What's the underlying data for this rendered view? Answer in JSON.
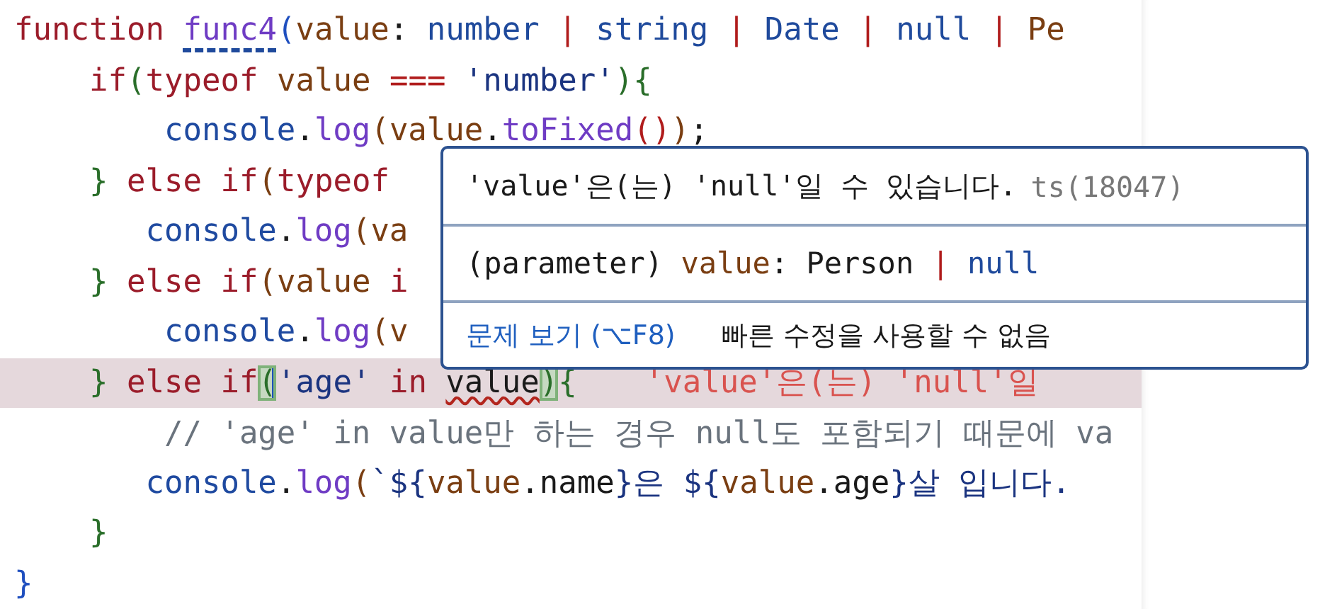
{
  "editor": {
    "lines": [
      {
        "highlighted": false,
        "tokens": [
          {
            "text": "function ",
            "kind": "keyword"
          },
          {
            "text": "func4",
            "kind": "function",
            "underlined": true
          },
          {
            "text": "(",
            "kind": "bracket-blue"
          },
          {
            "text": "value",
            "kind": "variable"
          },
          {
            "text": ":",
            "kind": "plain"
          },
          {
            "text": " number",
            "kind": "type"
          },
          {
            "text": " |",
            "kind": "operator"
          },
          {
            "text": " string",
            "kind": "type"
          },
          {
            "text": " |",
            "kind": "operator"
          },
          {
            "text": " Date",
            "kind": "type"
          },
          {
            "text": " |",
            "kind": "operator"
          },
          {
            "text": " null",
            "kind": "type"
          },
          {
            "text": " |",
            "kind": "operator"
          },
          {
            "text": " Pe",
            "kind": "variable"
          }
        ]
      },
      {
        "highlighted": false,
        "tokens": [
          {
            "text": "    if",
            "kind": "keyword"
          },
          {
            "text": "(",
            "kind": "bracket-green"
          },
          {
            "text": "typeof",
            "kind": "keyword"
          },
          {
            "text": " value",
            "kind": "variable"
          },
          {
            "text": " ===",
            "kind": "operator"
          },
          {
            "text": " 'number'",
            "kind": "string"
          },
          {
            "text": "){",
            "kind": "bracket-green"
          }
        ]
      },
      {
        "highlighted": false,
        "tokens": [
          {
            "text": "        console",
            "kind": "object"
          },
          {
            "text": ".",
            "kind": "plain"
          },
          {
            "text": "log",
            "kind": "function"
          },
          {
            "text": "(",
            "kind": "bracket-brown"
          },
          {
            "text": "value",
            "kind": "variable"
          },
          {
            "text": ".",
            "kind": "plain"
          },
          {
            "text": "toFixed",
            "kind": "function"
          },
          {
            "text": "()",
            "kind": "operator"
          },
          {
            "text": ")",
            "kind": "bracket-brown"
          },
          {
            "text": ";",
            "kind": "plain"
          }
        ]
      },
      {
        "highlighted": false,
        "tokens": [
          {
            "text": "    }",
            "kind": "bracket-green"
          },
          {
            "text": " else",
            "kind": "keyword"
          },
          {
            "text": " if",
            "kind": "keyword"
          },
          {
            "text": "(",
            "kind": "bracket-brown"
          },
          {
            "text": "typeof",
            "kind": "keyword"
          }
        ]
      },
      {
        "highlighted": false,
        "tokens": [
          {
            "text": "       console",
            "kind": "object"
          },
          {
            "text": ".",
            "kind": "plain"
          },
          {
            "text": "log",
            "kind": "function"
          },
          {
            "text": "(",
            "kind": "bracket-brown"
          },
          {
            "text": "va",
            "kind": "variable"
          }
        ]
      },
      {
        "highlighted": false,
        "tokens": [
          {
            "text": "    }",
            "kind": "bracket-green"
          },
          {
            "text": " else",
            "kind": "keyword"
          },
          {
            "text": " if",
            "kind": "keyword"
          },
          {
            "text": "(",
            "kind": "bracket-brown"
          },
          {
            "text": "value",
            "kind": "variable"
          },
          {
            "text": " i",
            "kind": "keyword"
          }
        ]
      },
      {
        "highlighted": false,
        "tokens": [
          {
            "text": "        console",
            "kind": "object"
          },
          {
            "text": ".",
            "kind": "plain"
          },
          {
            "text": "log",
            "kind": "function"
          },
          {
            "text": "(",
            "kind": "bracket-brown"
          },
          {
            "text": "v",
            "kind": "variable"
          }
        ]
      },
      {
        "highlighted": true,
        "diagnostic": "'value'은(는) 'null'일",
        "tokens": [
          {
            "text": "    }",
            "kind": "bracket-green"
          },
          {
            "text": " else",
            "kind": "keyword"
          },
          {
            "text": " if",
            "kind": "keyword"
          },
          {
            "text": "(",
            "kind": "bracket-green",
            "bracket_match": true
          },
          {
            "text": "'age'",
            "kind": "string",
            "caret": true
          },
          {
            "text": " in ",
            "kind": "keyword"
          },
          {
            "text": "value",
            "kind": "plain",
            "squiggle": true
          },
          {
            "text": ")",
            "kind": "bracket-green",
            "bracket_match": true
          },
          {
            "text": "{",
            "kind": "bracket-green"
          }
        ]
      },
      {
        "highlighted": false,
        "tokens": [
          {
            "text": "        // 'age' in value만 하는 경우 null도 포함되기 때문에 va",
            "kind": "comment"
          }
        ]
      },
      {
        "highlighted": false,
        "tokens": [
          {
            "text": "       console",
            "kind": "object"
          },
          {
            "text": ".",
            "kind": "plain"
          },
          {
            "text": "log",
            "kind": "function"
          },
          {
            "text": "(",
            "kind": "bracket-brown"
          },
          {
            "text": "`${",
            "kind": "string"
          },
          {
            "text": "value",
            "kind": "variable"
          },
          {
            "text": ".name",
            "kind": "plain"
          },
          {
            "text": "}은 ${",
            "kind": "string"
          },
          {
            "text": "value",
            "kind": "variable"
          },
          {
            "text": ".age",
            "kind": "plain"
          },
          {
            "text": "}살 입니다.",
            "kind": "string"
          }
        ]
      },
      {
        "highlighted": false,
        "tokens": [
          {
            "text": "    }",
            "kind": "bracket-green"
          }
        ]
      },
      {
        "highlighted": false,
        "tokens": [
          {
            "text": "}",
            "kind": "bracket-blue"
          }
        ]
      }
    ]
  },
  "hover": {
    "message": "'value'은(는) 'null'일 수 있습니다.",
    "code": "ts(18047)",
    "signature": [
      {
        "text": "(parameter)",
        "kind": "plain"
      },
      {
        "text": " value",
        "kind": "variable"
      },
      {
        "text": ": Person",
        "kind": "plain"
      },
      {
        "text": " |",
        "kind": "operator"
      },
      {
        "text": " null",
        "kind": "type"
      }
    ],
    "link": "문제 보기 (⌥F8)",
    "note": "빠른 수정을 사용할 수 없음"
  }
}
